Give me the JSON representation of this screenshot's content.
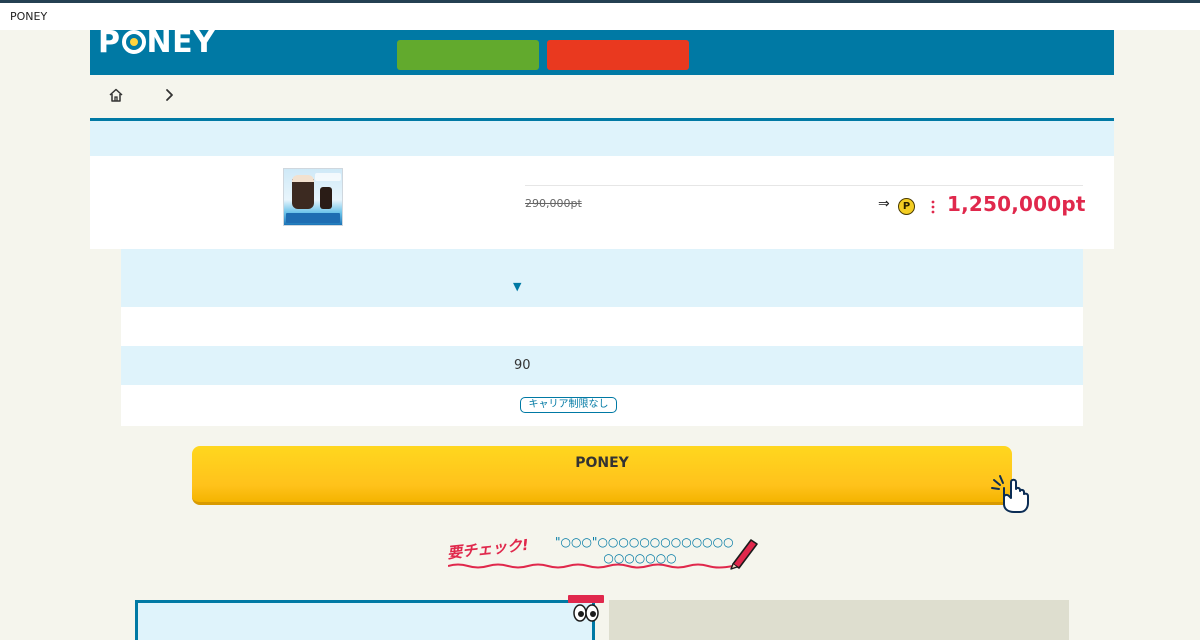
{
  "browser": {
    "tab_title": "PONEY"
  },
  "header": {
    "logo_text_1": "P",
    "logo_text_2": "NEY",
    "nav_buttons": [
      {
        "name": "register",
        "color": "#62aa2d"
      },
      {
        "name": "login",
        "color": "#e9391f"
      }
    ]
  },
  "breadcrumb": {
    "home_icon": "home-icon",
    "separator_icon": "chevron-right-icon"
  },
  "product": {
    "old_price": "290,000pt",
    "arrow": "⇒",
    "coin_icon_label": "P",
    "points": "1,250,000pt"
  },
  "details": {
    "toggle_caret": "▼",
    "count": "90",
    "carrier_badge": "キャリア制限なし"
  },
  "cta": {
    "label": "PONEY"
  },
  "check": {
    "stamp": "要チェック!",
    "line1": "\"○○○\"○○○○○○○○○○○○○",
    "line2": "○○○○○○○"
  },
  "colors": {
    "brand_blue": "#0079a4",
    "points_red": "#e0284c",
    "cta_yellow": "#ffc21b",
    "panel_blue": "#dff3fb",
    "page_bg": "#f5f5ed"
  }
}
